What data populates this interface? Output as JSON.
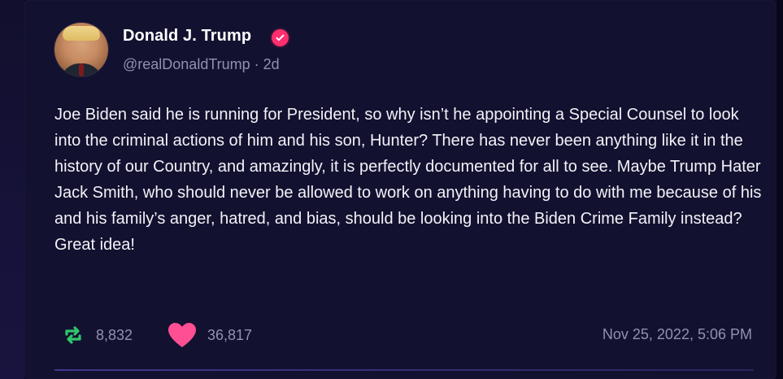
{
  "post": {
    "author": {
      "name": "Donald J. Trump",
      "handle": "@realDonaldTrump",
      "age": "2d"
    },
    "separator": "·",
    "text": "Joe Biden said he is running for President, so why isn’t he appointing a Special Counsel to look into the criminal actions of him and his son, Hunter? There has never been anything like it in the history of our Country, and amazingly, it is perfectly documented for all to see. Maybe Trump Hater Jack Smith, who should never be allowed to work on anything having to do with me because of his and his family’s anger, hatred, and bias, should be looking into the Biden Crime Family instead? Great idea!",
    "stats": {
      "reposts": "8,832",
      "likes": "36,817"
    },
    "timestamp": "Nov 25, 2022, 5:06 PM"
  },
  "colors": {
    "background": "#07061a",
    "card": "#131130",
    "verified_badge": "#ff2e6d",
    "repost_icon": "#31c56b",
    "like_icon": "#ff4f93",
    "muted_text": "#8f93ad"
  },
  "icons": {
    "verified": "verified-badge-icon",
    "repost": "repost-icon",
    "like": "heart-icon"
  }
}
